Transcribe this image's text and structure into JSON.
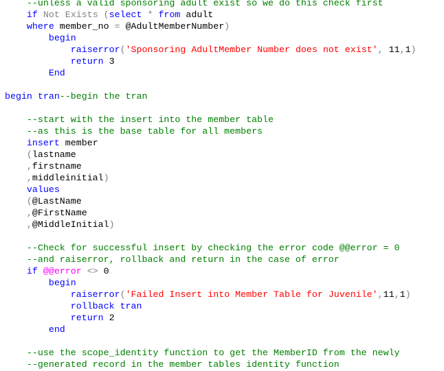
{
  "editor": {
    "language": "T-SQL",
    "colors": {
      "keyword": "#0000ff",
      "comment": "#008000",
      "string": "#ff0000",
      "operator": "#808080",
      "system_variable": "#ff00ff",
      "identifier": "#000000"
    },
    "lines": [
      [
        {
          "t": "    "
        },
        {
          "c": "cm",
          "t": "--unless a valid sponsoring adult exist so we do this check first"
        }
      ],
      [
        {
          "t": "    "
        },
        {
          "c": "kw",
          "t": "if"
        },
        {
          "t": " "
        },
        {
          "c": "op",
          "t": "Not Exists ("
        },
        {
          "c": "kw",
          "t": "select"
        },
        {
          "t": " "
        },
        {
          "c": "op",
          "t": "*"
        },
        {
          "t": " "
        },
        {
          "c": "kw",
          "t": "from"
        },
        {
          "t": " adult"
        }
      ],
      [
        {
          "t": "    "
        },
        {
          "c": "kw",
          "t": "where"
        },
        {
          "t": " member_no "
        },
        {
          "c": "op",
          "t": "="
        },
        {
          "t": " @AdultMemberNumber"
        },
        {
          "c": "op",
          "t": ")"
        }
      ],
      [
        {
          "t": "        "
        },
        {
          "c": "kw",
          "t": "begin"
        }
      ],
      [
        {
          "t": "            "
        },
        {
          "c": "kw",
          "t": "raiserror"
        },
        {
          "c": "op",
          "t": "("
        },
        {
          "c": "str",
          "t": "'Sponsoring AdultMember Number does not exist'"
        },
        {
          "c": "op",
          "t": ","
        },
        {
          "t": " 11"
        },
        {
          "c": "op",
          "t": ","
        },
        {
          "t": "1"
        },
        {
          "c": "op",
          "t": ")"
        }
      ],
      [
        {
          "t": "            "
        },
        {
          "c": "kw",
          "t": "return"
        },
        {
          "t": " 3"
        }
      ],
      [
        {
          "t": "        "
        },
        {
          "c": "kw",
          "t": "End"
        }
      ],
      [],
      [
        {
          "c": "kw",
          "t": "begin tran"
        },
        {
          "c": "cm",
          "t": "--begin the tran"
        }
      ],
      [],
      [
        {
          "t": "    "
        },
        {
          "c": "cm",
          "t": "--start with the insert into the member table"
        }
      ],
      [
        {
          "t": "    "
        },
        {
          "c": "cm",
          "t": "--as this is the base table for all members"
        }
      ],
      [
        {
          "t": "    "
        },
        {
          "c": "kw",
          "t": "insert"
        },
        {
          "t": " member"
        }
      ],
      [
        {
          "t": "    "
        },
        {
          "c": "op",
          "t": "("
        },
        {
          "t": "lastname"
        }
      ],
      [
        {
          "t": "    "
        },
        {
          "c": "op",
          "t": ","
        },
        {
          "t": "firstname"
        }
      ],
      [
        {
          "t": "    "
        },
        {
          "c": "op",
          "t": ","
        },
        {
          "t": "middleinitial"
        },
        {
          "c": "op",
          "t": ")"
        }
      ],
      [
        {
          "t": "    "
        },
        {
          "c": "kw",
          "t": "values"
        }
      ],
      [
        {
          "t": "    "
        },
        {
          "c": "op",
          "t": "("
        },
        {
          "t": "@LastName"
        }
      ],
      [
        {
          "t": "    "
        },
        {
          "c": "op",
          "t": ","
        },
        {
          "t": "@FirstName"
        }
      ],
      [
        {
          "t": "    "
        },
        {
          "c": "op",
          "t": ","
        },
        {
          "t": "@MiddleInitial"
        },
        {
          "c": "op",
          "t": ")"
        }
      ],
      [],
      [
        {
          "t": "    "
        },
        {
          "c": "cm",
          "t": "--Check for successful insert by checking the error code @@error = 0"
        }
      ],
      [
        {
          "t": "    "
        },
        {
          "c": "cm",
          "t": "--and raiserror, rollback and return in the case of error"
        }
      ],
      [
        {
          "t": "    "
        },
        {
          "c": "kw",
          "t": "if"
        },
        {
          "t": " "
        },
        {
          "c": "sysvar",
          "t": "@@error"
        },
        {
          "t": " "
        },
        {
          "c": "op",
          "t": "<>"
        },
        {
          "t": " 0"
        }
      ],
      [
        {
          "t": "        "
        },
        {
          "c": "kw",
          "t": "begin"
        }
      ],
      [
        {
          "t": "            "
        },
        {
          "c": "kw",
          "t": "raiserror"
        },
        {
          "c": "op",
          "t": "("
        },
        {
          "c": "str",
          "t": "'Failed Insert into Member Table for Juvenile'"
        },
        {
          "c": "op",
          "t": ","
        },
        {
          "t": "11"
        },
        {
          "c": "op",
          "t": ","
        },
        {
          "t": "1"
        },
        {
          "c": "op",
          "t": ")"
        }
      ],
      [
        {
          "t": "            "
        },
        {
          "c": "kw",
          "t": "rollback tran"
        }
      ],
      [
        {
          "t": "            "
        },
        {
          "c": "kw",
          "t": "return"
        },
        {
          "t": " 2"
        }
      ],
      [
        {
          "t": "        "
        },
        {
          "c": "kw",
          "t": "end"
        }
      ],
      [],
      [
        {
          "t": "    "
        },
        {
          "c": "cm",
          "t": "--use the scope_identity function to get the MemberID from the newly"
        }
      ],
      [
        {
          "t": "    "
        },
        {
          "c": "cm",
          "t": "--generated record in the member tables identity function"
        }
      ]
    ]
  }
}
